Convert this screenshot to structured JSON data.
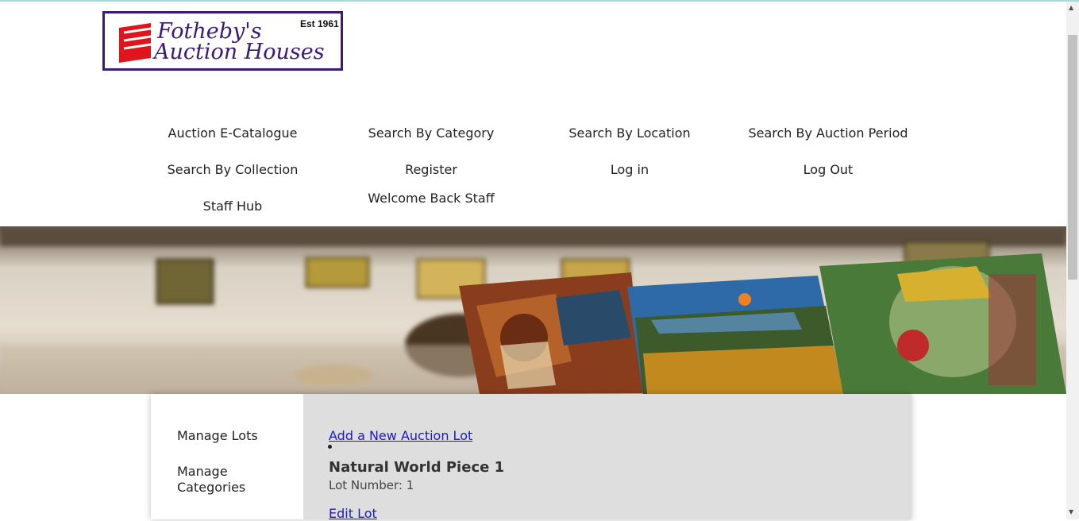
{
  "logo": {
    "line1": "Fotheby's",
    "line2": "Auction Houses",
    "est": "Est 1961"
  },
  "nav": {
    "items": [
      {
        "label": "Auction E-Catalogue"
      },
      {
        "label": "Search By Category"
      },
      {
        "label": "Search By Location"
      },
      {
        "label": "Search By Auction Period"
      },
      {
        "label": "Search By Collection"
      },
      {
        "label": "Register"
      },
      {
        "label": "Log in"
      },
      {
        "label": "Log Out"
      },
      {
        "label": "Staff Hub"
      },
      {
        "label": "Welcome Back Staff"
      }
    ]
  },
  "sidebar": {
    "items": [
      {
        "label": "Manage Lots"
      },
      {
        "label": "Manage Categories"
      }
    ]
  },
  "main": {
    "add_link": "Add a New Auction Lot",
    "lots": [
      {
        "title": "Natural World Piece 1",
        "number_text": "Lot Number: 1",
        "edit_link": "Edit Lot"
      }
    ]
  },
  "colors": {
    "logo_border": "#3b1a78",
    "logo_text": "#3b1a78",
    "logo_shield": "#e0141c",
    "link": "#1a1acc",
    "main_bg": "#dedede"
  }
}
